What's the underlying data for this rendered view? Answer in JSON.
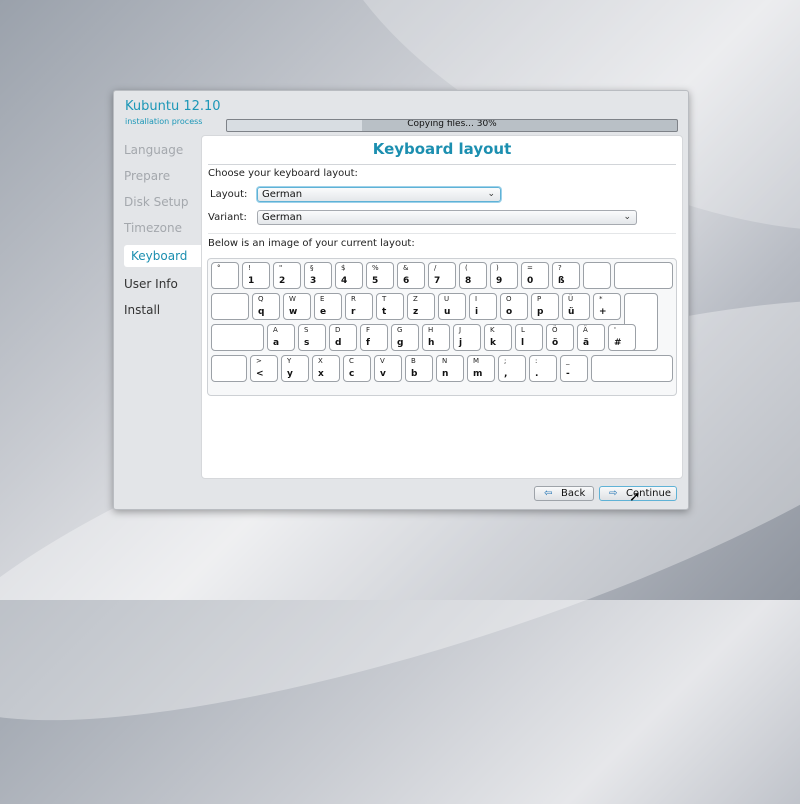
{
  "app": {
    "name": "Kubuntu 12.10",
    "subtitle": "installation process"
  },
  "progress": {
    "text": "Copying files... 30%",
    "value": 0.3
  },
  "steps": [
    "Language",
    "Prepare",
    "Disk Setup",
    "Timezone",
    "Keyboard",
    "User Info",
    "Install"
  ],
  "active_step": "Keyboard",
  "panel": {
    "title": "Keyboard layout",
    "choose_label": "Choose your keyboard layout:",
    "layout_label": "Layout:",
    "layout_value": "German",
    "variant_label": "Variant:",
    "variant_value": "German",
    "image_label": "Below is an image of your current layout:"
  },
  "keyboard": {
    "row1": [
      {
        "t": "°",
        "b": ""
      },
      {
        "t": "!",
        "b": "1"
      },
      {
        "t": "\"",
        "b": "2"
      },
      {
        "t": "§",
        "b": "3"
      },
      {
        "t": "$",
        "b": "4"
      },
      {
        "t": "%",
        "b": "5"
      },
      {
        "t": "&",
        "b": "6"
      },
      {
        "t": "/",
        "b": "7"
      },
      {
        "t": "(",
        "b": "8"
      },
      {
        "t": ")",
        "b": "9"
      },
      {
        "t": "=",
        "b": "0"
      },
      {
        "t": "?",
        "b": "ß"
      },
      {
        "t": "",
        "b": ""
      }
    ],
    "row2": [
      {
        "t": "Q",
        "b": "q"
      },
      {
        "t": "W",
        "b": "w"
      },
      {
        "t": "E",
        "b": "e"
      },
      {
        "t": "R",
        "b": "r"
      },
      {
        "t": "T",
        "b": "t"
      },
      {
        "t": "Z",
        "b": "z"
      },
      {
        "t": "U",
        "b": "u"
      },
      {
        "t": "I",
        "b": "i"
      },
      {
        "t": "O",
        "b": "o"
      },
      {
        "t": "P",
        "b": "p"
      },
      {
        "t": "Ü",
        "b": "ü"
      },
      {
        "t": "*",
        "b": "+"
      }
    ],
    "row3": [
      {
        "t": "A",
        "b": "a"
      },
      {
        "t": "S",
        "b": "s"
      },
      {
        "t": "D",
        "b": "d"
      },
      {
        "t": "F",
        "b": "f"
      },
      {
        "t": "G",
        "b": "g"
      },
      {
        "t": "H",
        "b": "h"
      },
      {
        "t": "J",
        "b": "j"
      },
      {
        "t": "K",
        "b": "k"
      },
      {
        "t": "L",
        "b": "l"
      },
      {
        "t": "Ö",
        "b": "ö"
      },
      {
        "t": "Ä",
        "b": "ä"
      },
      {
        "t": "'",
        "b": "#"
      }
    ],
    "row4": [
      {
        "t": ">",
        "b": "<"
      },
      {
        "t": "Y",
        "b": "y"
      },
      {
        "t": "X",
        "b": "x"
      },
      {
        "t": "C",
        "b": "c"
      },
      {
        "t": "V",
        "b": "v"
      },
      {
        "t": "B",
        "b": "b"
      },
      {
        "t": "N",
        "b": "n"
      },
      {
        "t": "M",
        "b": "m"
      },
      {
        "t": ";",
        "b": ","
      },
      {
        "t": ":",
        "b": "."
      },
      {
        "t": "_",
        "b": "-"
      }
    ]
  },
  "buttons": {
    "back": "Back",
    "continue": "Continue"
  },
  "icons": {
    "back": "arrow-left-icon",
    "continue": "arrow-right-icon",
    "dropdown": "chevron-down-icon"
  },
  "colors": {
    "accent": "#1c8fb0"
  }
}
